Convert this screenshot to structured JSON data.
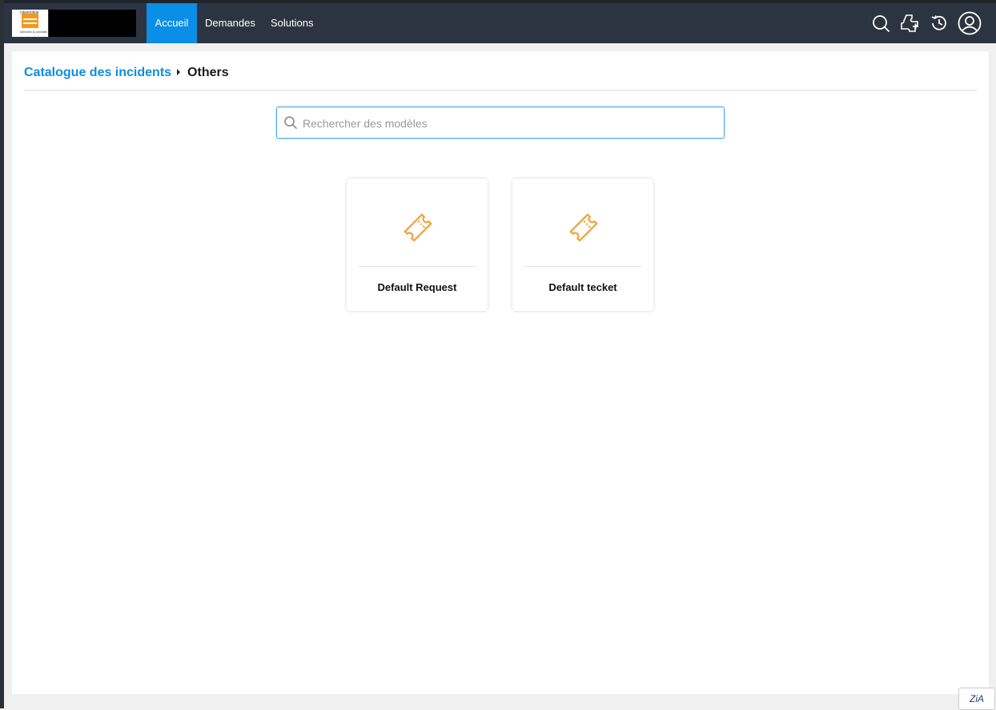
{
  "header": {
    "logo_top_text": "cikeenikoe",
    "logo_bottom_text": "services & produits",
    "tabs": [
      {
        "label": "Accueil",
        "active": true
      },
      {
        "label": "Demandes",
        "active": false
      },
      {
        "label": "Solutions",
        "active": false
      }
    ],
    "icons": [
      "search-icon",
      "new-ticket-icon",
      "history-icon",
      "user-avatar-icon"
    ]
  },
  "breadcrumb": {
    "parent": "Catalogue des incidents",
    "current": "Others"
  },
  "search": {
    "placeholder": "Rechercher des modèles",
    "value": ""
  },
  "templates": [
    {
      "label": "Default Request",
      "icon": "ticket-icon"
    },
    {
      "label": "Default tecket",
      "icon": "ticket-icon"
    }
  ],
  "assistant": {
    "label": "ZiA"
  },
  "colors": {
    "topbar": "#2d3441",
    "accent": "#0a8ee6",
    "icon_orange": "#f5a03a",
    "link": "#0f8de0"
  }
}
